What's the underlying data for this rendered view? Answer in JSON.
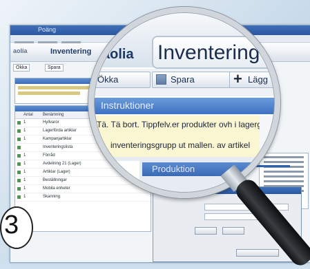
{
  "app": {
    "window_title": "Poäng",
    "tabs": [
      "Inventering",
      "Inventering",
      "aolia"
    ],
    "toolbar": [
      "Ökka",
      "Spara"
    ]
  },
  "list": {
    "columns": [
      "Antal",
      "Benämning"
    ],
    "rows": [
      {
        "qty": "1",
        "name": "Hyllvaror"
      },
      {
        "qty": "1",
        "name": "Lagerförda artiklar"
      },
      {
        "qty": "1",
        "name": "Kampanjartiklar"
      },
      {
        "qty": "",
        "name": "Inventeringslista"
      },
      {
        "qty": "1",
        "name": "Förråd"
      },
      {
        "qty": "1",
        "name": "Avdelning 21 (Lager)"
      },
      {
        "qty": "1",
        "name": "Artiklar (Lager)"
      },
      {
        "qty": "1",
        "name": "Beställningar"
      },
      {
        "qty": "1",
        "name": "Mobila enheter"
      },
      {
        "qty": "1",
        "name": "Skanning"
      }
    ]
  },
  "magnifier": {
    "brand": "aolia",
    "title": "Inventering",
    "buttons": [
      "Ökka",
      "Spara",
      "Lägg"
    ],
    "section_header": "Instruktioner",
    "instruction_line1": "Tä. Tä bort. Tippfelv.er produkter ovh i lagergrenad",
    "instruction_line2": "inventeringsgrupp ut mallen. av artikel",
    "lower_header": "Produktion"
  },
  "badge": {
    "number": "3"
  },
  "colors": {
    "accent": "#3e6fb8",
    "yellow_note": "#fbf6d2",
    "handle": "#111315"
  },
  "icons": [
    "save-icon",
    "plus-icon",
    "green-row-icon"
  ]
}
